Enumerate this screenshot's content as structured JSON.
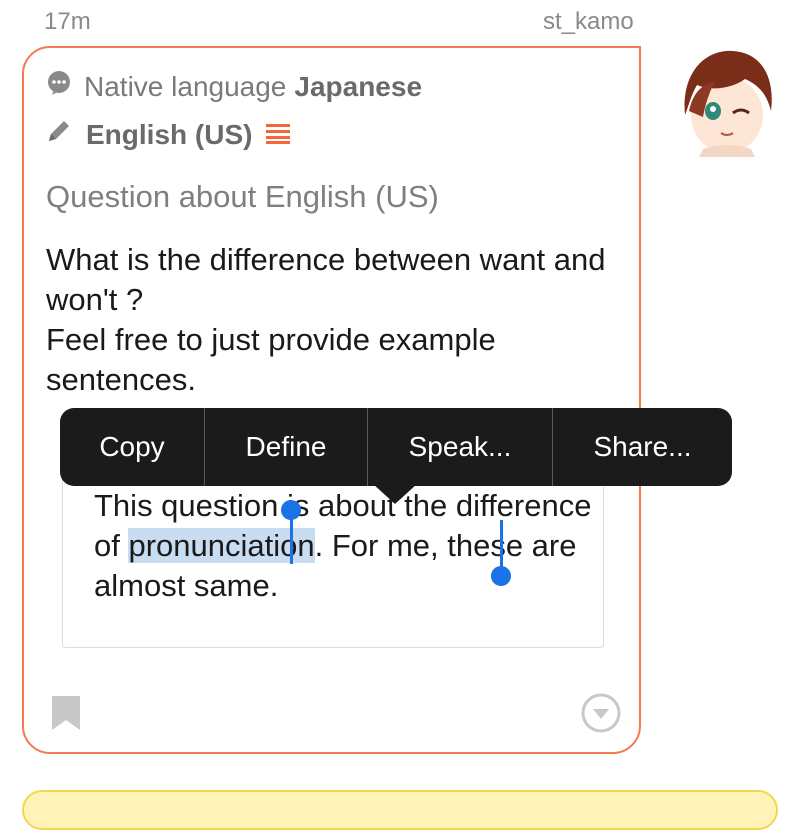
{
  "header": {
    "time": "17m",
    "username": "st_kamo"
  },
  "question": {
    "native_label": "Native language",
    "native_value": "Japanese",
    "studying_language": "English (US)",
    "title": "Question about English (US)",
    "body": "What is the difference between want and won't ?\nFeel free to just provide example sentences."
  },
  "answer": {
    "text_before": "This question is about the difference of ",
    "selected": "pronunciation",
    "text_after": ". For me, these are almost same."
  },
  "context_menu": {
    "items": [
      "Copy",
      "Define",
      "Speak...",
      "Share..."
    ]
  },
  "colors": {
    "accent": "#f47a4f",
    "selection": "#1b73e8",
    "menu_bg": "#1b1b1b"
  },
  "icons": {
    "native_language": "speech-bubble-icon",
    "studying_language": "pencil-icon",
    "level": "level-bars-icon",
    "bookmark": "bookmark-icon",
    "more": "chevron-down-circle-icon"
  }
}
